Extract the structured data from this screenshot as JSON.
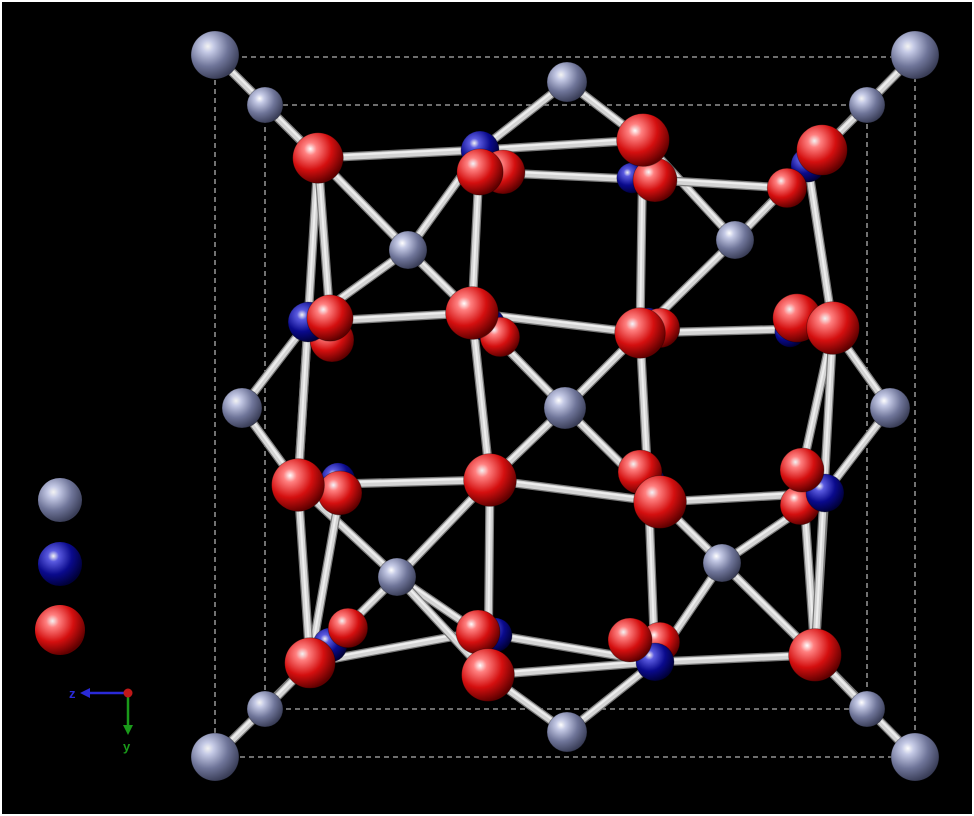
{
  "structure": {
    "description_label": "",
    "atom_types": [
      {
        "id": "A",
        "color": "#6f7599",
        "highlight": "#c5cae6",
        "shade": "#3a3e58",
        "radius_scale": 1.0
      },
      {
        "id": "B",
        "color": "#0a0a8c",
        "highlight": "#5a5ae0",
        "shade": "#00003a",
        "radius_scale": 0.95
      },
      {
        "id": "C",
        "color": "#d40f0f",
        "highlight": "#ff8080",
        "shade": "#600000",
        "radius_scale": 1.1
      }
    ],
    "bond_color": "#d4d4d4",
    "cell_line_color": "#cfcfcf",
    "background": "#000000"
  },
  "legend": {
    "items": [
      {
        "type": "A"
      },
      {
        "type": "B"
      },
      {
        "type": "C"
      }
    ]
  },
  "axes_indicator": {
    "labels": [
      {
        "text": "z",
        "color": "#2a2ad8"
      },
      {
        "text": "y",
        "color": "#1a9a1a"
      }
    ],
    "origin_color": "#c01818"
  }
}
